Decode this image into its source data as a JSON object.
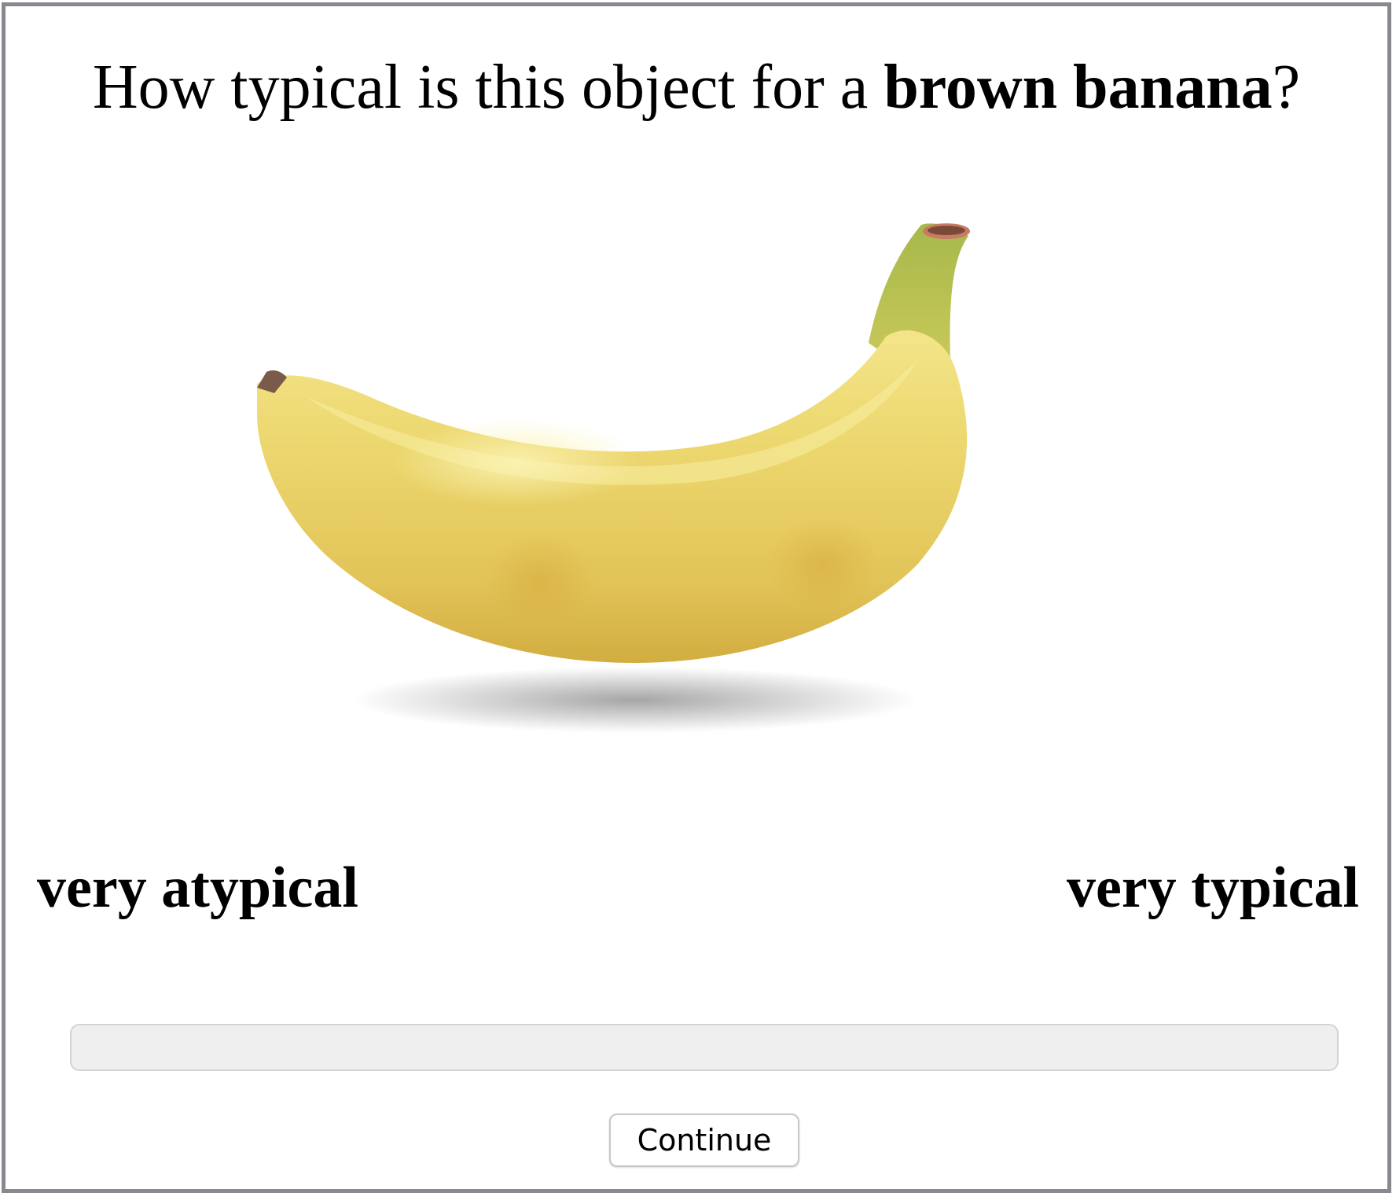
{
  "question": {
    "prefix": "How typical is this object for a ",
    "target": "brown banana",
    "suffix": "?"
  },
  "stimulus": {
    "object_icon": "banana-image",
    "object_color": "#e8cf5f"
  },
  "scale": {
    "left_label": "very atypical",
    "right_label": "very typical"
  },
  "slider": {
    "value": null
  },
  "buttons": {
    "continue_label": "Continue"
  },
  "colors": {
    "frame_border": "#88888f",
    "slider_track": "#efefef"
  }
}
